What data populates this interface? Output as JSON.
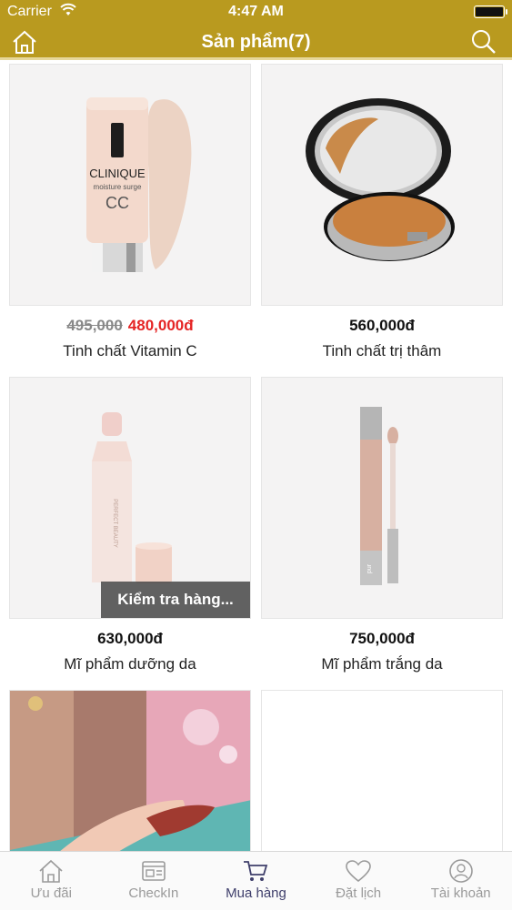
{
  "status_bar": {
    "carrier": "Carrier",
    "time": "4:47 AM"
  },
  "nav": {
    "title": "Sản phẩm(7)"
  },
  "products": [
    {
      "old_price": "495,000",
      "price": "480,000đ",
      "name": "Tinh chất Vitamin C",
      "brand_text": "CLINIQUE",
      "sub_text": "moisture surge",
      "badge_text": "CC"
    },
    {
      "price": "560,000đ",
      "name": "Tinh chất trị thâm"
    },
    {
      "price": "630,000đ",
      "name": "Mĩ phẩm dưỡng da",
      "overlay": "Kiểm tra hàng...",
      "bottle_text": "PERFECT BEAUTY"
    },
    {
      "price": "750,000đ",
      "name": "Mĩ phẩm trắng da",
      "tube_text": "pur"
    },
    {},
    {}
  ],
  "tabs": [
    {
      "label": "Ưu đãi",
      "icon": "home-icon"
    },
    {
      "label": "CheckIn",
      "icon": "checkin-icon"
    },
    {
      "label": "Mua hàng",
      "icon": "cart-icon",
      "active": true
    },
    {
      "label": "Đặt lịch",
      "icon": "heart-icon"
    },
    {
      "label": "Tài khoản",
      "icon": "user-icon"
    }
  ],
  "colors": {
    "header": "#b99a1f",
    "price_sale": "#e52424",
    "tab_active": "#3f3f6b",
    "tab_inactive": "#9a9a9a"
  }
}
